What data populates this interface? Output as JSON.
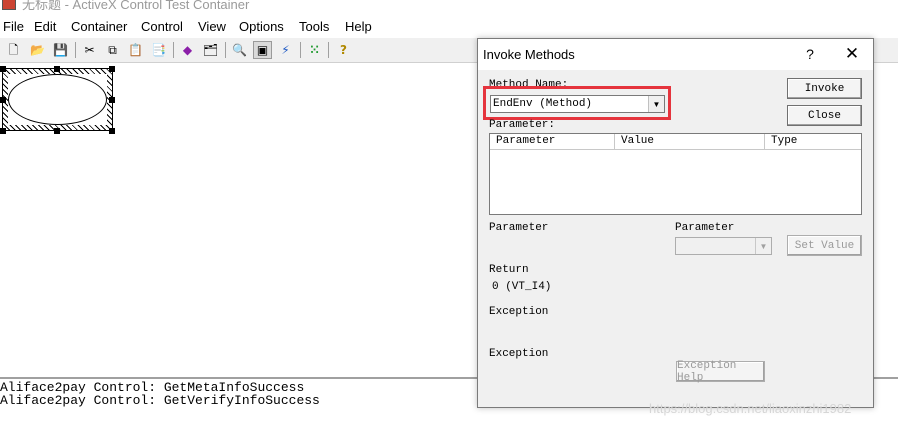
{
  "window": {
    "title": "无标题 - ActiveX Control Test Container"
  },
  "menu": [
    "File",
    "Edit",
    "Container",
    "Control",
    "View",
    "Options",
    "Tools",
    "Help"
  ],
  "toolbar": {
    "buttons": [
      {
        "name": "new-icon",
        "glyph": "🗋"
      },
      {
        "name": "open-folder-icon",
        "glyph": "📂"
      },
      {
        "name": "save-icon",
        "glyph": "💾"
      },
      {
        "name": "cut-icon",
        "glyph": "✂"
      },
      {
        "name": "copy-icon",
        "glyph": "⧉"
      },
      {
        "name": "paste-icon",
        "glyph": "📋"
      },
      {
        "name": "paste-special-icon",
        "glyph": "📑"
      },
      {
        "name": "insert-control-icon",
        "glyph": "◆"
      },
      {
        "name": "properties-icon",
        "glyph": "🗂"
      },
      {
        "name": "view-events-icon",
        "glyph": "🔍"
      },
      {
        "name": "invoke-methods-icon",
        "glyph": "▣"
      },
      {
        "name": "lightning-icon",
        "glyph": "⚡"
      },
      {
        "name": "toggle-design-mode-icon",
        "glyph": "⁙"
      },
      {
        "name": "help-icon",
        "glyph": "?"
      }
    ]
  },
  "output": {
    "lines": [
      "Aliface2pay Control: GetMetaInfoSuccess",
      "Aliface2pay Control: GetVerifyInfoSuccess"
    ]
  },
  "dialog": {
    "title": "Invoke Methods",
    "help_glyph": "?",
    "close_glyph": "✕",
    "method_name_label": "Method Name:",
    "method_value": "EndEnv (Method)",
    "parameter_label": "Parameter:",
    "columns": [
      "Parameter",
      "Value",
      "Type"
    ],
    "invoke_label": "Invoke",
    "close_label": "Close",
    "parameter_value_label": "Parameter",
    "parameter_type_label": "Parameter",
    "set_value_label": "Set Value",
    "return_label": "Return",
    "return_value": "0 (VT_I4)",
    "exception_label_1": "Exception",
    "exception_label_2": "Exception",
    "exception_help_label": "Exception Help",
    "highlight_color": "#e5343d"
  },
  "watermark": "https://blog.csdn.net/liaoxinzhi1982"
}
